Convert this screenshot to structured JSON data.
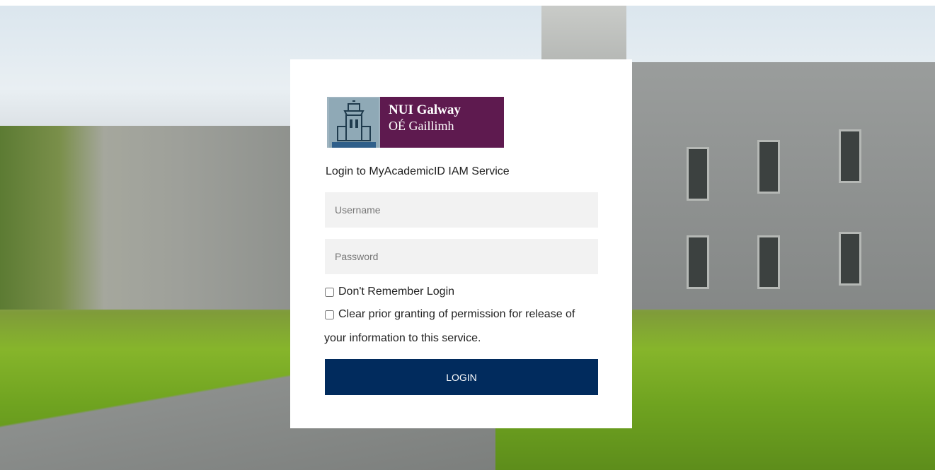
{
  "logo": {
    "line1": "NUI Galway",
    "line2": "OÉ Gaillimh",
    "crest_icon": "university-tower-crest"
  },
  "login": {
    "title": "Login to MyAcademicID IAM Service",
    "username_placeholder": "Username",
    "password_placeholder": "Password",
    "dont_remember_label": "Don't Remember Login",
    "clear_permission_label_1": "Clear prior granting of permission for release of",
    "clear_permission_label_2": "your information to this service.",
    "login_button": "LOGIN"
  },
  "colors": {
    "logo_purple": "#5e1a4f",
    "button_navy": "#012b5d",
    "input_bg": "#f2f2f2"
  }
}
